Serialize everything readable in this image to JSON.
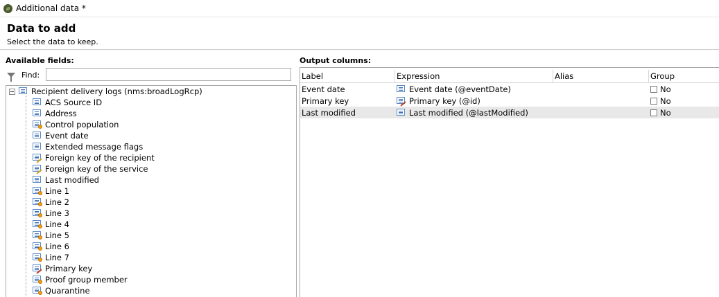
{
  "window": {
    "title": "Additional data *"
  },
  "header": {
    "title": "Data to add",
    "subtitle": "Select the data to keep."
  },
  "left": {
    "label": "Available fields:",
    "find_label": "Find:",
    "find_value": "",
    "tree": {
      "root": {
        "label": "Recipient delivery logs (nms:broadLogRcp)",
        "icon": "table-icon",
        "expanded": true
      },
      "items": [
        {
          "label": "ACS Source ID",
          "icon": "field-icon"
        },
        {
          "label": "Address",
          "icon": "field-icon"
        },
        {
          "label": "Control population",
          "icon": "computed-field-icon"
        },
        {
          "label": "Event date",
          "icon": "field-icon"
        },
        {
          "label": "Extended message flags",
          "icon": "field-icon"
        },
        {
          "label": "Foreign key of the recipient",
          "icon": "foreign-key-icon"
        },
        {
          "label": "Foreign key of the service",
          "icon": "foreign-key-icon"
        },
        {
          "label": "Last modified",
          "icon": "field-icon"
        },
        {
          "label": "Line 1",
          "icon": "computed-field-icon"
        },
        {
          "label": "Line 2",
          "icon": "computed-field-icon"
        },
        {
          "label": "Line 3",
          "icon": "computed-field-icon"
        },
        {
          "label": "Line 4",
          "icon": "computed-field-icon"
        },
        {
          "label": "Line 5",
          "icon": "computed-field-icon"
        },
        {
          "label": "Line 6",
          "icon": "computed-field-icon"
        },
        {
          "label": "Line 7",
          "icon": "computed-field-icon"
        },
        {
          "label": "Primary key",
          "icon": "primary-key-icon"
        },
        {
          "label": "Proof group member",
          "icon": "computed-field-icon"
        },
        {
          "label": "Quarantine",
          "icon": "computed-field-icon"
        }
      ]
    }
  },
  "right": {
    "label": "Output columns:",
    "columns": [
      "Label",
      "Expression",
      "Alias",
      "Group"
    ],
    "rows": [
      {
        "label": "Event date",
        "expression": "Event date (@eventDate)",
        "expr_icon": "field-icon",
        "alias": "",
        "group": "No",
        "selected": false
      },
      {
        "label": "Primary key",
        "expression": "Primary key (@id)",
        "expr_icon": "primary-key-icon",
        "alias": "",
        "group": "No",
        "selected": false
      },
      {
        "label": "Last modified",
        "expression": "Last modified (@lastModified)",
        "expr_icon": "field-icon",
        "alias": "",
        "group": "No",
        "selected": true
      }
    ]
  }
}
